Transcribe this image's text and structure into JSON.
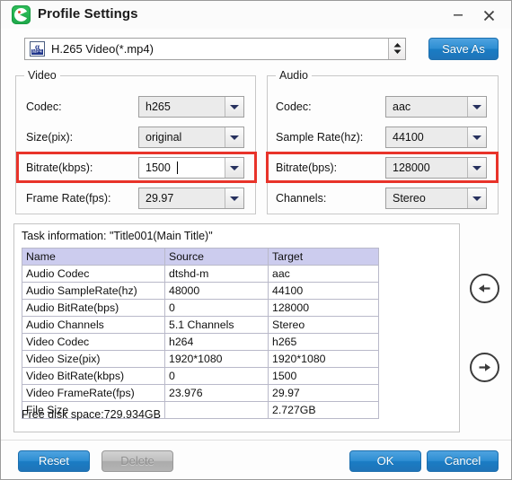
{
  "window": {
    "title": "Profile Settings",
    "app_icon": "profile-app-icon",
    "minimize_label": "–",
    "close_label": "×"
  },
  "profile": {
    "icon": "mp4-format-icon",
    "selected": "H.265 Video(*.mp4)",
    "spinner": "spinner-up-down-icon",
    "save_as_label": "Save As"
  },
  "video": {
    "legend": "Video",
    "fields": [
      {
        "label": "Codec:",
        "value": "h265",
        "editable": false
      },
      {
        "label": "Size(pix):",
        "value": "original",
        "editable": false
      },
      {
        "label": "Bitrate(kbps):",
        "value": "1500",
        "editable": true
      },
      {
        "label": "Frame Rate(fps):",
        "value": "29.97",
        "editable": false
      }
    ]
  },
  "audio": {
    "legend": "Audio",
    "fields": [
      {
        "label": "Codec:",
        "value": "aac",
        "editable": false
      },
      {
        "label": "Sample Rate(hz):",
        "value": "44100",
        "editable": false
      },
      {
        "label": "Bitrate(bps):",
        "value": "128000",
        "editable": false
      },
      {
        "label": "Channels:",
        "value": "Stereo",
        "editable": false
      }
    ]
  },
  "highlight_color": "#e8332a",
  "task": {
    "title": "Task information: \"Title001(Main Title)\"",
    "columns": [
      "Name",
      "Source",
      "Target"
    ],
    "rows": [
      [
        "Audio Codec",
        "dtshd-m",
        "aac"
      ],
      [
        "Audio SampleRate(hz)",
        "48000",
        "44100"
      ],
      [
        "Audio BitRate(bps)",
        "0",
        "128000"
      ],
      [
        "Audio Channels",
        "5.1 Channels",
        "Stereo"
      ],
      [
        "Video Codec",
        "h264",
        "h265"
      ],
      [
        "Video Size(pix)",
        "1920*1080",
        "1920*1080"
      ],
      [
        "Video BitRate(kbps)",
        "0",
        "1500"
      ],
      [
        "Video FrameRate(fps)",
        "23.976",
        "29.97"
      ],
      [
        "File Size",
        "",
        "2.727GB"
      ]
    ],
    "disk_space": "Free disk space:729.934GB"
  },
  "nav": {
    "prev": "arrow-left-circle-icon",
    "next": "arrow-right-circle-icon"
  },
  "footer": {
    "reset_label": "Reset",
    "delete_label": "Delete",
    "ok_label": "OK",
    "cancel_label": "Cancel"
  }
}
